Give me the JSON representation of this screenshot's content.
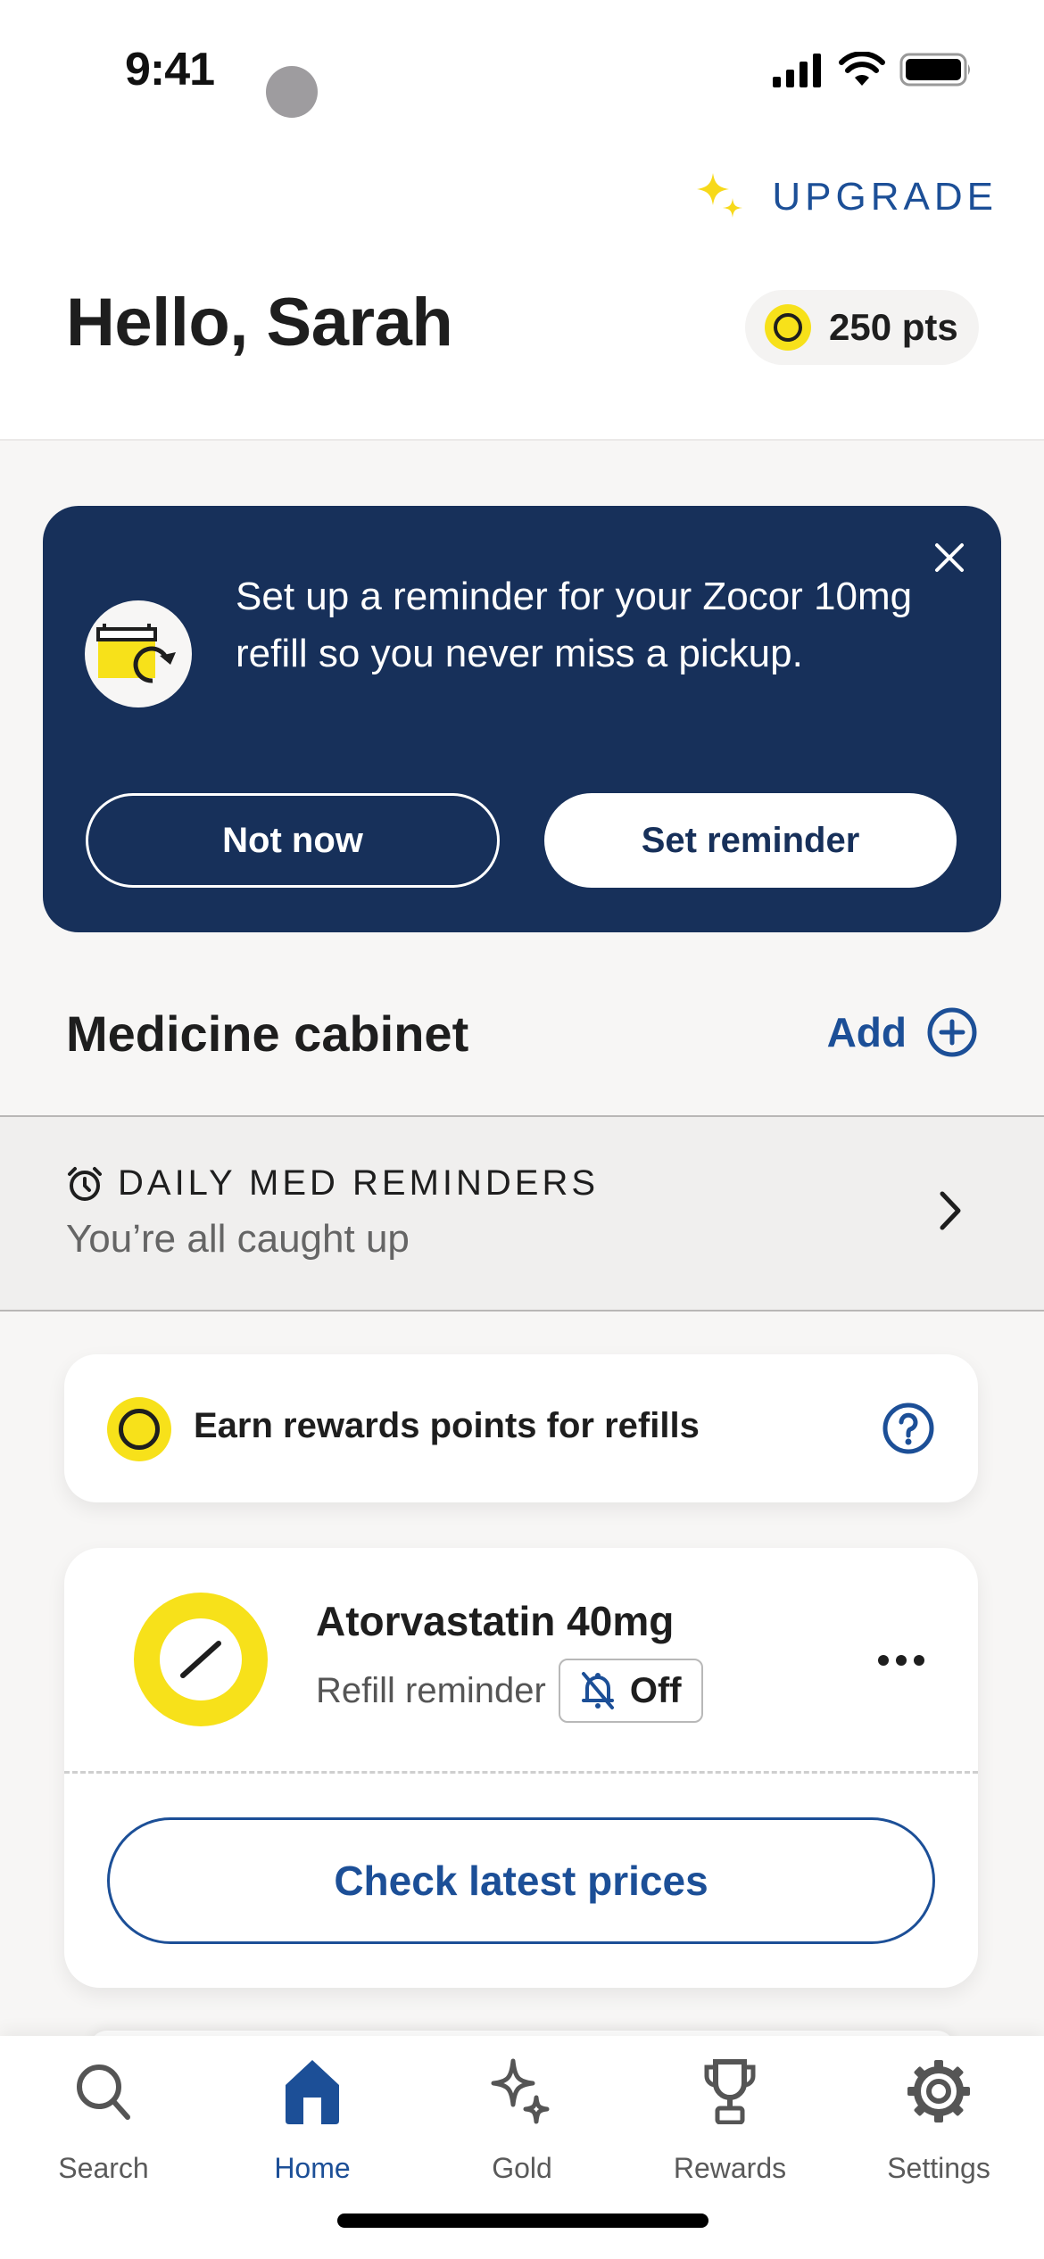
{
  "status_bar": {
    "time": "9:41"
  },
  "header": {
    "upgrade_label": "UPGRADE",
    "greeting": "Hello, Sarah",
    "points_label": "250 pts"
  },
  "banner": {
    "message": "Set up a reminder for your Zocor 10mg refill so you never miss a pickup.",
    "not_now_label": "Not now",
    "set_reminder_label": "Set reminder"
  },
  "cabinet": {
    "title": "Medicine cabinet",
    "add_label": "Add"
  },
  "daily_reminders": {
    "title": "DAILY MED REMINDERS",
    "status": "You’re all caught up"
  },
  "rewards_card": {
    "text": "Earn rewards points for refills"
  },
  "medications": [
    {
      "name": "Atorvastatin 40mg",
      "reminder_label": "Refill reminder",
      "reminder_state": "Off",
      "action_label": "Check latest prices"
    }
  ],
  "tabbar": {
    "items": [
      {
        "label": "Search",
        "icon": "search-icon",
        "active": false
      },
      {
        "label": "Home",
        "icon": "home-icon",
        "active": true
      },
      {
        "label": "Gold",
        "icon": "sparkles-icon",
        "active": false
      },
      {
        "label": "Rewards",
        "icon": "trophy-icon",
        "active": false
      },
      {
        "label": "Settings",
        "icon": "gear-icon",
        "active": false
      }
    ]
  },
  "colors": {
    "brand_blue": "#1c4f97",
    "banner_navy": "#17305a",
    "accent_yellow": "#f7e11a",
    "background": "#f7f6f5"
  }
}
